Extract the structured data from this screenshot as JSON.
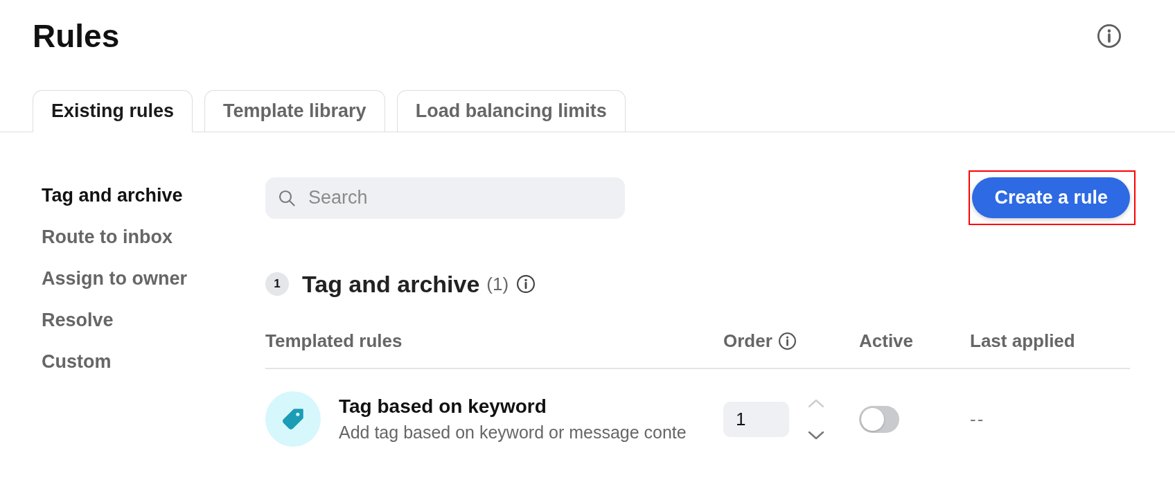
{
  "page": {
    "title": "Rules"
  },
  "tabs": [
    {
      "label": "Existing rules",
      "selected": true
    },
    {
      "label": "Template library",
      "selected": false
    },
    {
      "label": "Load balancing limits",
      "selected": false
    }
  ],
  "sidebar": {
    "items": [
      {
        "label": "Tag and archive",
        "selected": true
      },
      {
        "label": "Route to inbox",
        "selected": false
      },
      {
        "label": "Assign to owner",
        "selected": false
      },
      {
        "label": "Resolve",
        "selected": false
      },
      {
        "label": "Custom",
        "selected": false
      }
    ]
  },
  "search": {
    "placeholder": "Search"
  },
  "create_button": {
    "label": "Create a rule",
    "highlighted": true
  },
  "section": {
    "number": "1",
    "title": "Tag and archive",
    "count": "(1)"
  },
  "table": {
    "columns": [
      {
        "label": "Templated rules",
        "info": false
      },
      {
        "label": "Order",
        "info": true
      },
      {
        "label": "Active",
        "info": false
      },
      {
        "label": "Last applied",
        "info": false
      }
    ],
    "rows": [
      {
        "name": "Tag based on keyword",
        "description": "Add tag based on keyword or message conte",
        "order": "1",
        "order_up_disabled": true,
        "order_down_disabled": false,
        "active": false,
        "last_applied": "--"
      }
    ]
  }
}
